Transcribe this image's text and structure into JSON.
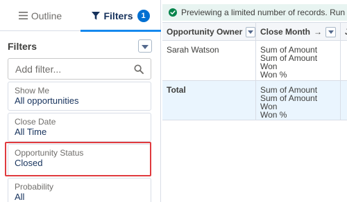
{
  "tabs": {
    "outline_label": "Outline",
    "filters_label": "Filters",
    "filters_count": "1"
  },
  "filters_panel": {
    "heading": "Filters",
    "add_filter_placeholder": "Add filter...",
    "items": [
      {
        "name": "Show Me",
        "value": "All opportunities"
      },
      {
        "name": "Close Date",
        "value": "All Time"
      },
      {
        "name": "Opportunity Status",
        "value": "Closed"
      },
      {
        "name": "Probability",
        "value": "All"
      }
    ]
  },
  "banner": {
    "text": "Previewing a limited number of records. Run th"
  },
  "grid": {
    "headers": [
      "Opportunity Owner",
      "Close Month",
      "J"
    ],
    "sort_arrow": "→",
    "rows": [
      {
        "owner": "Sarah Watson",
        "measures": "Sum of Amount\nSum of Amount Won\nWon %"
      }
    ],
    "total": {
      "label": "Total",
      "measures": "Sum of Amount\nSum of Amount Won\nWon %"
    }
  },
  "colors": {
    "accent": "#1589ee",
    "badge": "#0070d2",
    "highlight": "#e03a3e",
    "banner_bg": "#e8f4f1",
    "success": "#04844b",
    "total_row_bg": "#eaf5fe"
  },
  "icons": [
    "list-icon",
    "filter-funnel-icon",
    "chevron-down-icon",
    "search-icon",
    "check-circle-icon"
  ]
}
